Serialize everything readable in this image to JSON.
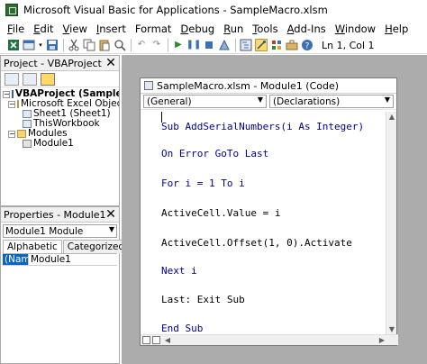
{
  "window": {
    "title": "Microsoft Visual Basic for Applications - SampleMacro.xlsm"
  },
  "menu": {
    "items": [
      {
        "underline": "F",
        "rest": "ile"
      },
      {
        "underline": "E",
        "rest": "dit"
      },
      {
        "underline": "V",
        "rest": "iew"
      },
      {
        "underline": "I",
        "rest": "nsert"
      },
      {
        "underline": "",
        "rest": "Format"
      },
      {
        "underline": "D",
        "rest": "ebug"
      },
      {
        "underline": "R",
        "rest": "un"
      },
      {
        "underline": "T",
        "rest": "ools"
      },
      {
        "underline": "A",
        "rest": "dd-Ins"
      },
      {
        "underline": "W",
        "rest": "indow"
      },
      {
        "underline": "H",
        "rest": "elp"
      }
    ]
  },
  "toolbar": {
    "status": "Ln 1, Col 1"
  },
  "project_pane": {
    "title": "Project - VBAProject",
    "tree": {
      "root": "VBAProject (SampleMacro",
      "excel_objects": "Microsoft Excel Objects",
      "sheet1": "Sheet1 (Sheet1)",
      "thisworkbook": "ThisWorkbook",
      "modules": "Modules",
      "module1": "Module1"
    }
  },
  "properties_pane": {
    "title": "Properties - Module1",
    "object_select": "Module1 Module",
    "tabs": [
      "Alphabetic",
      "Categorized"
    ],
    "rows": [
      {
        "key": "(Name)",
        "value": "Module1"
      }
    ]
  },
  "code_window": {
    "title": "SampleMacro.xlsm - Module1 (Code)",
    "object_combo": "(General)",
    "procedure_combo": "(Declarations)",
    "lines": [
      "Sub AddSerialNumbers(i As Integer)",
      "On Error GoTo Last",
      "For i = 1 To i",
      "ActiveCell.Value = i",
      "ActiveCell.Offset(1, 0).Activate",
      "Next i",
      "Last: Exit Sub",
      "End Sub"
    ]
  },
  "colors": {
    "mdi_background": "#acacac",
    "keyword_blue": "#00008b",
    "selection_blue": "#0a64c8"
  }
}
